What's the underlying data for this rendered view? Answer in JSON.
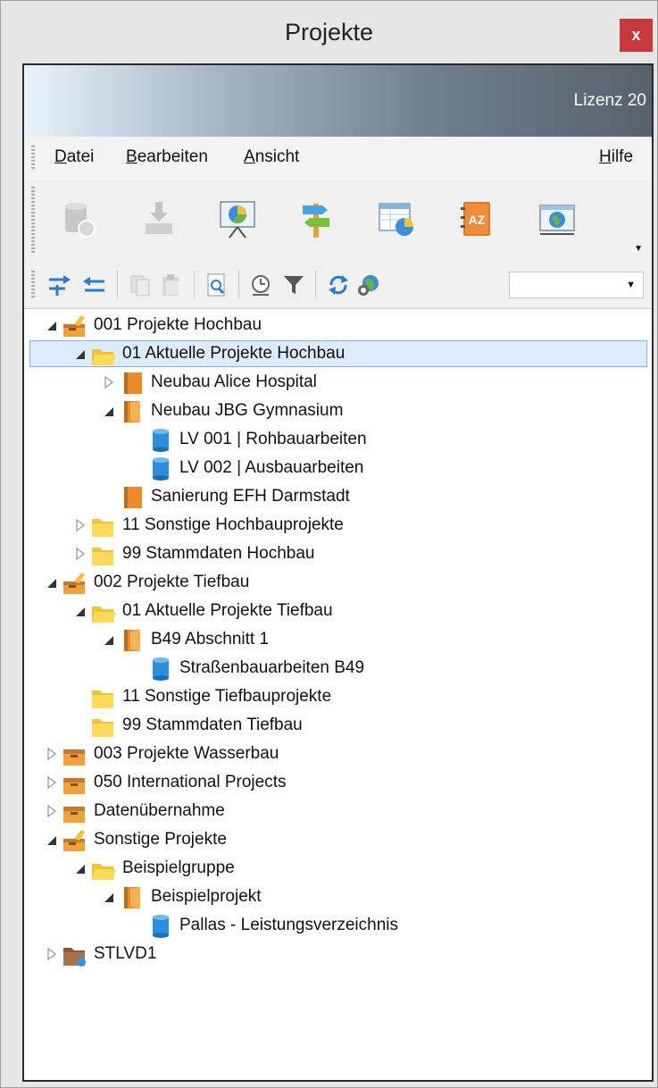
{
  "window": {
    "title": "Projekte",
    "close_label": "x"
  },
  "banner": {
    "text": "Lizenz 20"
  },
  "menu": {
    "items": [
      {
        "label": "Datei"
      },
      {
        "label": "Bearbeiten"
      },
      {
        "label": "Ansicht"
      }
    ],
    "help": "Hilfe"
  },
  "toolbar_icons": [
    "database-icon",
    "import-icon",
    "presentation-chart-icon",
    "signpost-icon",
    "spreadsheet-chart-icon",
    "address-book-az-icon",
    "globe-window-icon"
  ],
  "toolbar2_icons": [
    "indent-icon",
    "outdent-icon",
    "copy-icon",
    "paste-icon",
    "search-document-icon",
    "clock-icon",
    "filter-icon",
    "refresh-icon",
    "globe-link-icon"
  ],
  "dropdown": {
    "value": ""
  },
  "tree": [
    {
      "label": "001 Projekte Hochbau",
      "level": 0,
      "type": "project-open",
      "exp": "expanded"
    },
    {
      "label": "01 Aktuelle Projekte Hochbau",
      "level": 1,
      "type": "folder-open",
      "exp": "expanded",
      "selected": true
    },
    {
      "label": "Neubau Alice Hospital",
      "level": 2,
      "type": "book-closed",
      "exp": "collapsed"
    },
    {
      "label": "Neubau JBG Gymnasium",
      "level": 2,
      "type": "book-open",
      "exp": "expanded"
    },
    {
      "label": "LV 001 | Rohbauarbeiten",
      "level": 3,
      "type": "cylinder",
      "exp": "none"
    },
    {
      "label": "LV 002 | Ausbauarbeiten",
      "level": 3,
      "type": "cylinder",
      "exp": "none"
    },
    {
      "label": "Sanierung EFH Darmstadt",
      "level": 2,
      "type": "book-closed",
      "exp": "none"
    },
    {
      "label": "11 Sonstige Hochbauprojekte",
      "level": 1,
      "type": "folder",
      "exp": "collapsed"
    },
    {
      "label": "99 Stammdaten Hochbau",
      "level": 1,
      "type": "folder",
      "exp": "collapsed"
    },
    {
      "label": "002 Projekte Tiefbau",
      "level": 0,
      "type": "project-open",
      "exp": "expanded"
    },
    {
      "label": "01 Aktuelle Projekte Tiefbau",
      "level": 1,
      "type": "folder-open",
      "exp": "expanded"
    },
    {
      "label": "B49 Abschnitt 1",
      "level": 2,
      "type": "book-open",
      "exp": "expanded"
    },
    {
      "label": "Straßenbauarbeiten B49",
      "level": 3,
      "type": "cylinder",
      "exp": "none"
    },
    {
      "label": "11 Sonstige Tiefbauprojekte",
      "level": 1,
      "type": "folder",
      "exp": "none"
    },
    {
      "label": "99 Stammdaten Tiefbau",
      "level": 1,
      "type": "folder",
      "exp": "none"
    },
    {
      "label": "003 Projekte Wasserbau",
      "level": 0,
      "type": "project-closed",
      "exp": "collapsed"
    },
    {
      "label": "050 International Projects",
      "level": 0,
      "type": "project-closed",
      "exp": "collapsed"
    },
    {
      "label": "Datenübernahme",
      "level": 0,
      "type": "project-closed",
      "exp": "collapsed"
    },
    {
      "label": "Sonstige Projekte",
      "level": 0,
      "type": "project-open",
      "exp": "expanded"
    },
    {
      "label": "Beispielgruppe",
      "level": 1,
      "type": "folder-open",
      "exp": "expanded"
    },
    {
      "label": "Beispielprojekt",
      "level": 2,
      "type": "book-open",
      "exp": "expanded"
    },
    {
      "label": "Pallas - Leistungsverzeichnis",
      "level": 3,
      "type": "cylinder",
      "exp": "none"
    },
    {
      "label": "STLVD1",
      "level": 0,
      "type": "brown-folder",
      "exp": "collapsed"
    }
  ]
}
